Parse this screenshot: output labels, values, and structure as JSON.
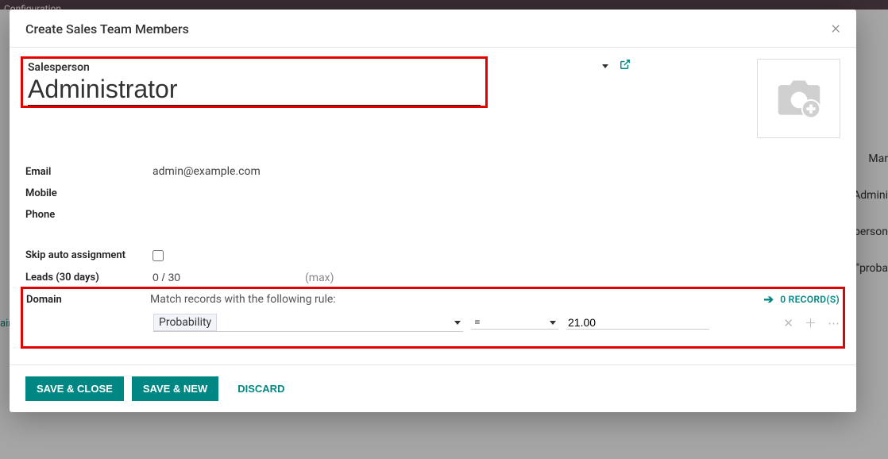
{
  "backdrop": {
    "top_text": "Configuration",
    "right_labels": [
      "Mar",
      "Admini",
      "person",
      "\"proba"
    ],
    "left_label": "ain"
  },
  "modal": {
    "title": "Create Sales Team Members",
    "salesperson": {
      "label": "Salesperson",
      "value": "Administrator"
    },
    "fields": {
      "email_label": "Email",
      "email_value": "admin@example.com",
      "mobile_label": "Mobile",
      "mobile_value": "",
      "phone_label": "Phone",
      "phone_value": "",
      "skip_label": "Skip auto assignment",
      "leads_label": "Leads (30 days)",
      "leads_value": "0 / 30",
      "leads_max": "(max)",
      "domain_label": "Domain",
      "domain_desc": "Match records with the following rule:",
      "records_count": "0 RECORD(S)",
      "rule_field": "Probability",
      "rule_operator": "=",
      "rule_value": "21.00"
    },
    "footer": {
      "save_close": "SAVE & CLOSE",
      "save_new": "SAVE & NEW",
      "discard": "DISCARD"
    }
  }
}
